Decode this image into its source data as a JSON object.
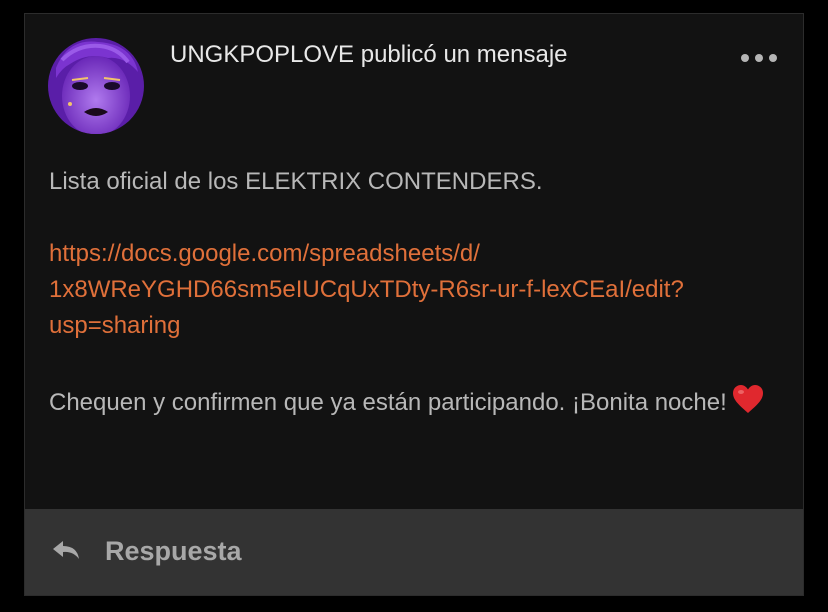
{
  "post": {
    "author": "UNGKPOPLOVE",
    "header_text": "UNGKPOPLOVE publicó un mensaje",
    "more_icon": "more-horizontal-icon",
    "avatar_icon": "user-avatar",
    "body": {
      "intro": "Lista oficial de los ELEKTRIX CONTENDERS.",
      "link_text": "https://docs.google.com/spreadsheets/d/\n1x8WReYGHD66sm5eIUCqUxTDty-R6sr-ur-f-lexCEaI/edit?\nusp=sharing",
      "closing": "Chequen y confirmen que ya están participando. ¡Bonita noche!"
    },
    "heart_icon": "red-heart-emoji"
  },
  "reply": {
    "label": "Respuesta",
    "icon": "reply-arrow-icon"
  },
  "colors": {
    "background": "#000000",
    "card": "#121212",
    "reply_bar": "#333333",
    "link": "#e0703a",
    "body_text": "#b8b8b8",
    "header_text": "#e8e8e8",
    "heart": "#e0282e",
    "avatar_purple": "#8a3fd8"
  }
}
